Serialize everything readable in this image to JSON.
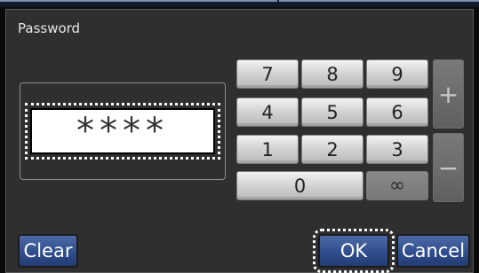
{
  "dialog": {
    "title": "Password"
  },
  "display": {
    "value": "****"
  },
  "keypad": {
    "k7": "7",
    "k8": "8",
    "k9": "9",
    "k4": "4",
    "k5": "5",
    "k6": "6",
    "k1": "1",
    "k2": "2",
    "k3": "3",
    "k0": "0",
    "inf": "∞",
    "plus": "+",
    "minus": "−"
  },
  "buttons": {
    "clear": "Clear",
    "ok": "OK",
    "cancel": "Cancel"
  },
  "colors": {
    "dialog_bg": "#2f2f2f",
    "button_blue": "#2e4c8c",
    "key_face": "#cfcfcf"
  }
}
